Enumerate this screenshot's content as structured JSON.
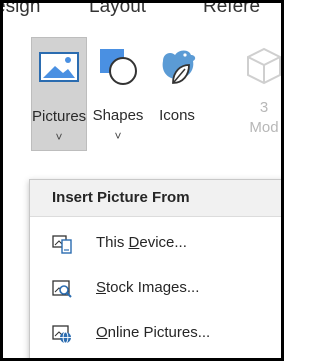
{
  "ribbon_tabs": [
    "esign",
    "Layout",
    "Refere"
  ],
  "ribbon_buttons": {
    "pictures": {
      "label": "Pictures",
      "icon": "picture-icon"
    },
    "shapes": {
      "label": "Shapes",
      "icon": "shapes-icon"
    },
    "icons": {
      "label": "Icons",
      "icon": "bird-leaf-icon"
    },
    "models3d": {
      "label_line1": "3",
      "label_line2": "Mod",
      "icon": "cube-icon"
    }
  },
  "dropdown_chevron": "˅",
  "insert_menu": {
    "header": "Insert Picture From",
    "items": [
      {
        "pre": "This ",
        "key": "D",
        "post": "evice...",
        "icon": "device-icon"
      },
      {
        "pre": "",
        "key": "S",
        "post": "tock Images...",
        "icon": "stock-images-icon"
      },
      {
        "pre": "",
        "key": "O",
        "post": "nline Pictures...",
        "icon": "online-pictures-icon"
      }
    ]
  },
  "colors": {
    "accent_blue": "#2b6cb0",
    "pressed_bg": "#d2d2d2",
    "menu_header_bg": "#f1f1f1"
  }
}
